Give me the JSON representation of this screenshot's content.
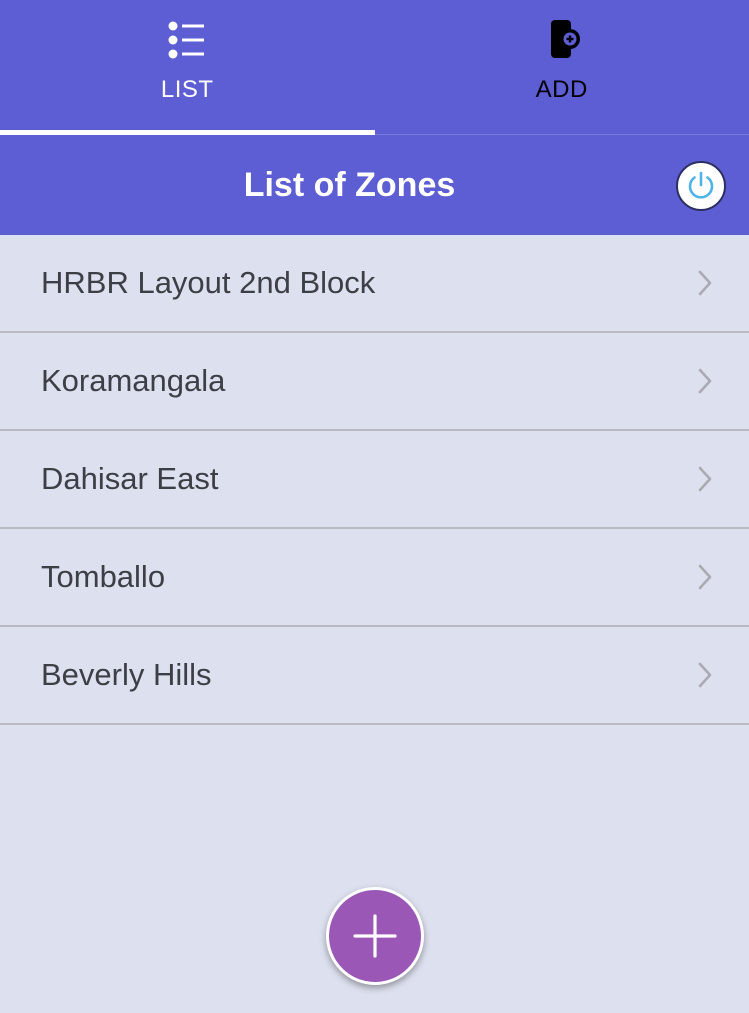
{
  "tabs": {
    "list": {
      "label": "LIST",
      "icon": "list-icon",
      "active": true
    },
    "add": {
      "label": "ADD",
      "icon": "add-device-icon",
      "active": false
    }
  },
  "header": {
    "title": "List of Zones",
    "power_icon": "power-icon"
  },
  "zones": [
    {
      "label": "HRBR Layout 2nd Block"
    },
    {
      "label": "Koramangala"
    },
    {
      "label": "Dahisar East"
    },
    {
      "label": "Tomballo"
    },
    {
      "label": "Beverly Hills"
    }
  ],
  "fab": {
    "icon": "plus-icon"
  },
  "colors": {
    "primary": "#5d5dd4",
    "background": "#dde0ee",
    "fab": "#9a57b6",
    "power_accent": "#4fb3ea",
    "chevron": "#a9aab3"
  }
}
